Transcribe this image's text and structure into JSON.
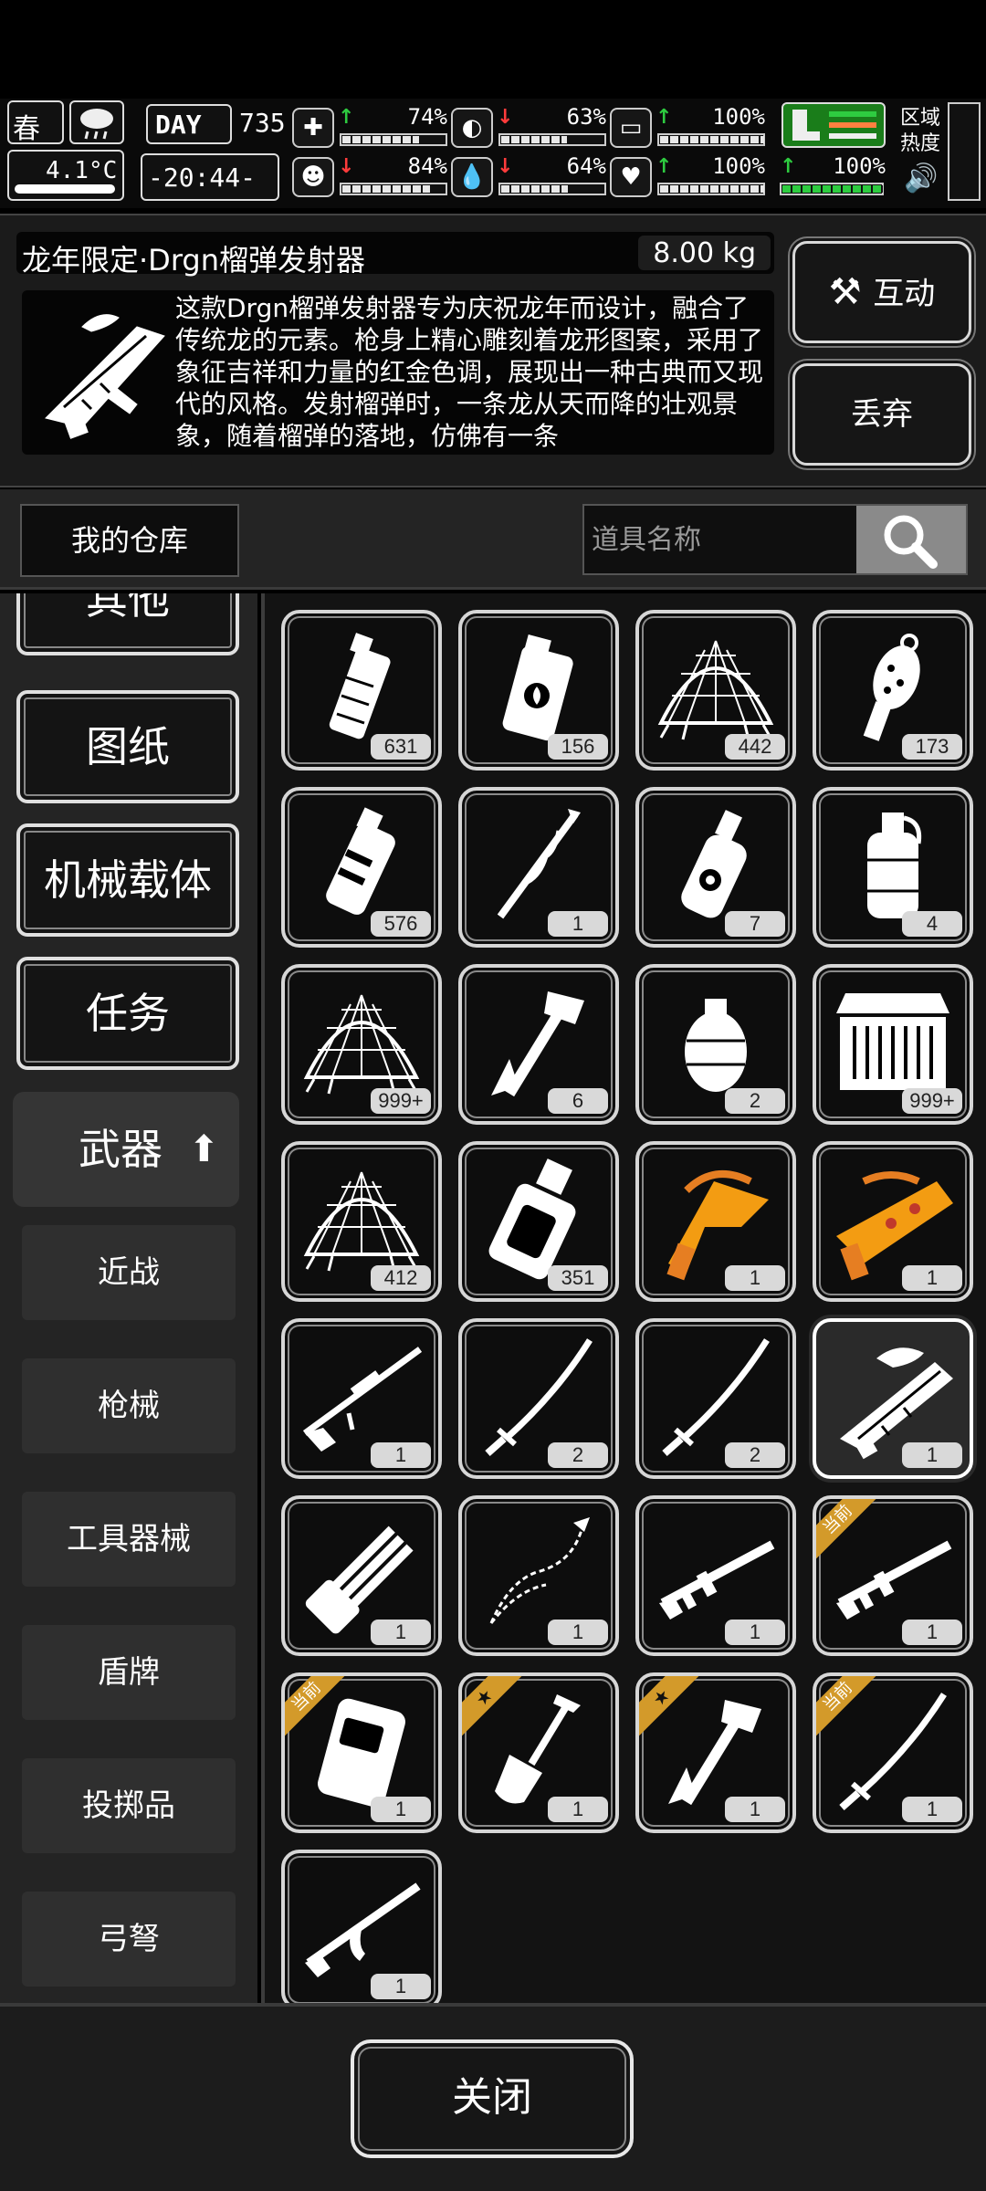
{
  "hud": {
    "season": "春",
    "temperature": "4.1°C",
    "day_label": "DAY",
    "day_value": "735",
    "time": "-20:44-",
    "zone_label": "区域热度",
    "stats": [
      {
        "name": "health",
        "arrow": "↑",
        "trend": "up",
        "value": "74%",
        "fill": 0.74
      },
      {
        "name": "hunger",
        "arrow": "↓",
        "trend": "down",
        "value": "63%",
        "fill": 0.63
      },
      {
        "name": "stamina",
        "arrow": "↑",
        "trend": "up",
        "value": "100%",
        "fill": 1.0
      },
      {
        "name": "mood",
        "arrow": "↓",
        "trend": "down",
        "value": "84%",
        "fill": 0.84
      },
      {
        "name": "thirst",
        "arrow": "↓",
        "trend": "down",
        "value": "64%",
        "fill": 0.64
      },
      {
        "name": "heart",
        "arrow": "↑",
        "trend": "up",
        "value": "100%",
        "fill": 1.0
      }
    ],
    "boots": {
      "arrow": "↑",
      "value": "100%"
    }
  },
  "detail": {
    "name": "龙年限定·Drgn榴弹发射器",
    "weight": "8.00 kg",
    "description": "这款Drgn榴弹发射器专为庆祝龙年而设计，融合了传统龙的元素。枪身上精心雕刻着龙形图案，采用了象征吉祥和力量的红金色调，展现出一种古典而又现代的风格。发射榴弹时，一条龙从天而降的壮观景象，随着榴弹的落地，仿佛有一条",
    "interact_label": "互动",
    "discard_label": "丢弃"
  },
  "storage": {
    "title": "我的仓库",
    "search_placeholder": "道具名称"
  },
  "categories": {
    "top": [
      "其他",
      "图纸",
      "机械载体",
      "任务"
    ],
    "active": "武器",
    "sub": [
      "近战",
      "枪械",
      "工具器械",
      "盾牌",
      "投掷品",
      "弓弩"
    ]
  },
  "items": [
    {
      "icon": "grenade-canister",
      "count": "631"
    },
    {
      "icon": "incendiary-grenade",
      "count": "156"
    },
    {
      "icon": "net-trap",
      "count": "442"
    },
    {
      "icon": "stick-grenade",
      "count": "173"
    },
    {
      "icon": "flashbang",
      "count": "576"
    },
    {
      "icon": "spiked-staff",
      "count": "1"
    },
    {
      "icon": "chemical-bottle",
      "count": "7"
    },
    {
      "icon": "smoke-grenade",
      "count": "4"
    },
    {
      "icon": "net-trap",
      "count": "999+"
    },
    {
      "icon": "hatchet",
      "count": "6"
    },
    {
      "icon": "frag-grenade",
      "count": "2"
    },
    {
      "icon": "ammo-crate",
      "count": "999+"
    },
    {
      "icon": "net-trap",
      "count": "412"
    },
    {
      "icon": "canteen",
      "count": "351"
    },
    {
      "icon": "golden-dragon-gun",
      "count": "1"
    },
    {
      "icon": "golden-dragon-launcher",
      "count": "1"
    },
    {
      "icon": "sniper-rifle",
      "count": "1"
    },
    {
      "icon": "katana",
      "count": "2"
    },
    {
      "icon": "katana",
      "count": "2"
    },
    {
      "icon": "dragon-launcher",
      "count": "1",
      "selected": true
    },
    {
      "icon": "minigun",
      "count": "1"
    },
    {
      "icon": "chain-whip",
      "count": "1"
    },
    {
      "icon": "assault-rifle",
      "count": "1"
    },
    {
      "icon": "assault-rifle",
      "count": "1",
      "badge": "当前"
    },
    {
      "icon": "backpack-shield",
      "count": "1",
      "badge": "当前"
    },
    {
      "icon": "shovel",
      "count": "1",
      "badge": "★"
    },
    {
      "icon": "hatchet",
      "count": "1",
      "badge": "★"
    },
    {
      "icon": "katana",
      "count": "1",
      "badge": "当前"
    },
    {
      "icon": "ak-rifle",
      "count": "1"
    }
  ],
  "footer": {
    "close_label": "关闭"
  },
  "colors": {
    "up": "#2ecc40",
    "down": "#ff3b3b",
    "gold": "#f39c12",
    "badge": "#d39a2a"
  }
}
